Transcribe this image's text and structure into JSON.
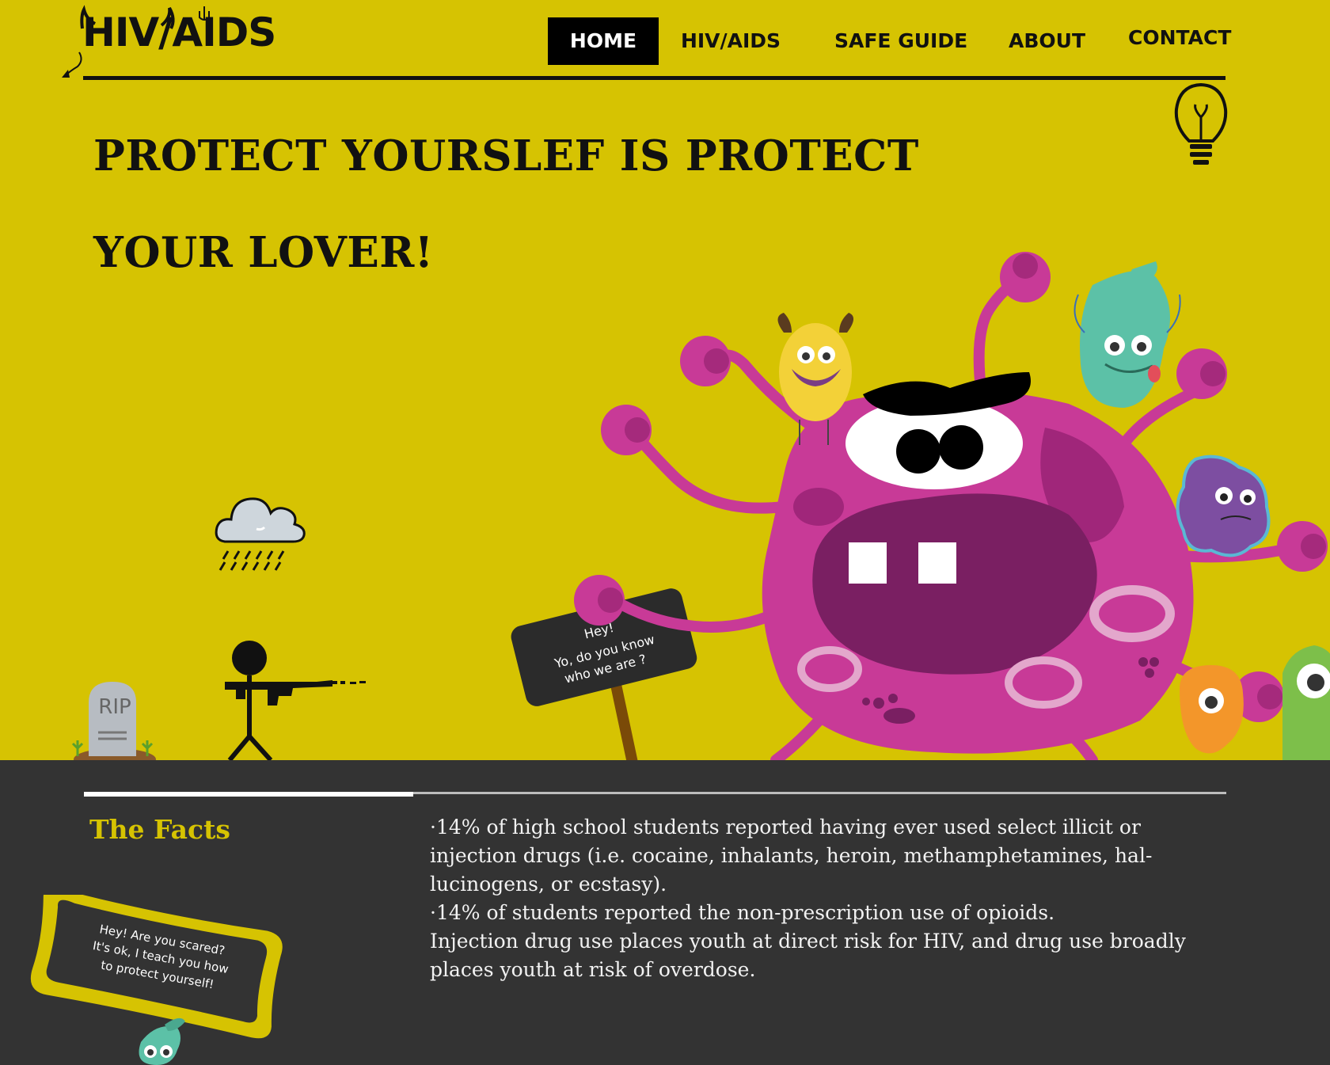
{
  "site": {
    "logo": "HIV/AIDS"
  },
  "nav": {
    "items": [
      {
        "label": "HOME",
        "active": true
      },
      {
        "label": "HIV/AIDS",
        "active": false
      },
      {
        "label": "SAFE GUIDE",
        "active": false
      },
      {
        "label": "ABOUT",
        "active": false
      },
      {
        "label": "CONTACT",
        "active": false
      }
    ]
  },
  "hero": {
    "headline_line1": "PROTECT YOURSLEF IS PROTECT",
    "headline_line2": "YOUR LOVER!",
    "tombstone_text": "RIP",
    "sign_lines": [
      "Hey!",
      "Yo,  do you know",
      "who we are ?"
    ]
  },
  "facts": {
    "title": "The Facts",
    "paragraphs": [
      "·14% of high school students reported having ever used select illicit or injection drugs (i.e. cocaine, inhalants, heroin, methamphetamines, hal­lucinogens, or ecstasy).",
      "·14% of students reported the non-prescription use of opioids.",
      "Injection drug use places youth at direct risk for HIV, and drug use broadly places youth at risk of overdose."
    ],
    "banner_lines": [
      "Hey! Are you scared?",
      "It's ok, I teach you how",
      "to protect yourself!"
    ]
  },
  "colors": {
    "brand_yellow": "#d6c302",
    "dark": "#333333",
    "monster_pink": "#c83a97"
  },
  "icons": [
    "lightbulb-icon",
    "rain-cloud-icon"
  ]
}
